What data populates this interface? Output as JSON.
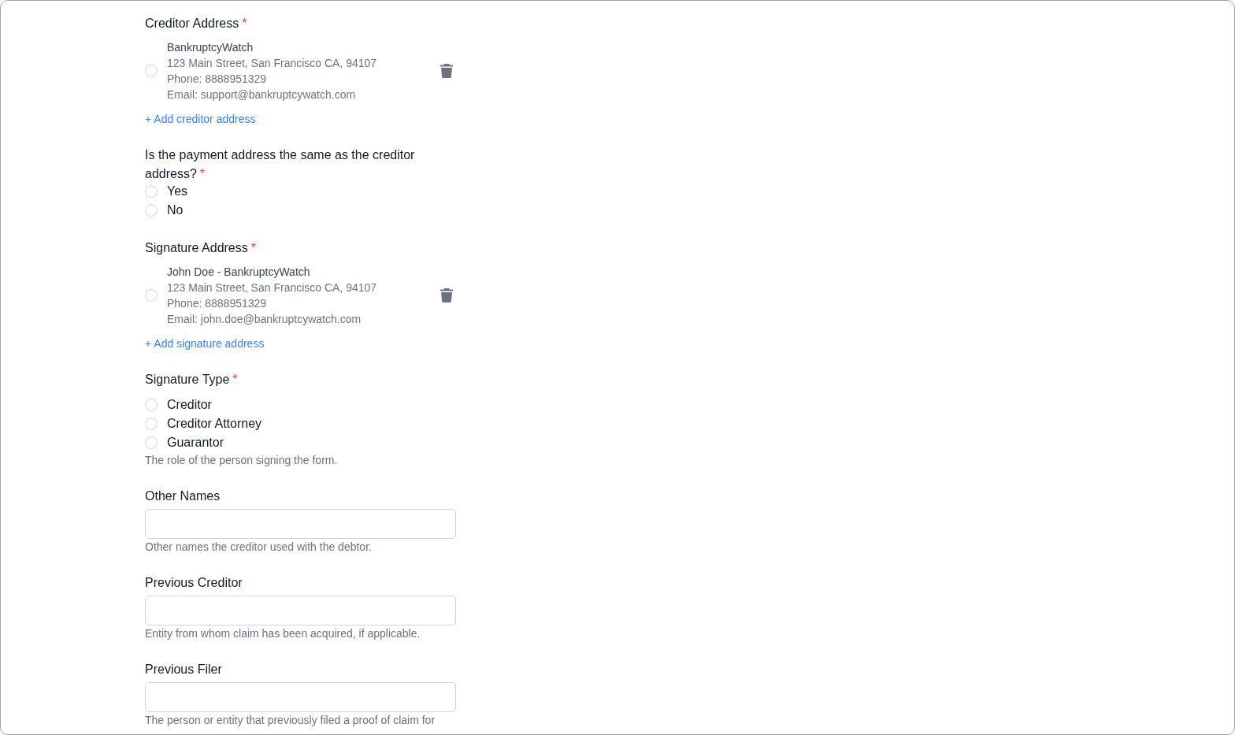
{
  "sections": [
    {
      "kind": "address_list",
      "label": "Creditor Address",
      "required_mark": "*",
      "addresses": [
        {
          "name": "BankruptcyWatch",
          "lines": [
            "123 Main Street, San Francisco CA, 94107",
            "Phone: 8888951329",
            "Email: support@bankruptcywatch.com"
          ],
          "selected": false
        }
      ],
      "add_link": "+ Add creditor address"
    },
    {
      "kind": "radio_group",
      "label": "Is the payment address the same as the creditor address?",
      "required_mark": "*",
      "options": [
        {
          "label": "Yes",
          "selected": false
        },
        {
          "label": "No",
          "selected": false
        }
      ]
    },
    {
      "kind": "address_list",
      "label": "Signature Address",
      "required_mark": "*",
      "addresses": [
        {
          "name": "John Doe - BankruptcyWatch",
          "lines": [
            "123 Main Street, San Francisco CA, 94107",
            "Phone: 8888951329",
            "Email: john.doe@bankruptcywatch.com"
          ],
          "selected": false
        }
      ],
      "add_link": "+ Add signature address"
    },
    {
      "kind": "radio_group",
      "label": "Signature Type",
      "required_mark": "*",
      "options": [
        {
          "label": "Creditor",
          "selected": false
        },
        {
          "label": "Creditor Attorney",
          "selected": false
        },
        {
          "label": "Guarantor",
          "selected": false
        }
      ],
      "help": "The role of the person signing the form."
    },
    {
      "kind": "text_field",
      "label": "Other Names",
      "help": "Other names the creditor used with the debtor."
    },
    {
      "kind": "text_field",
      "label": "Previous Creditor",
      "help": "Entity from whom claim has been acquired, if applicable."
    },
    {
      "kind": "text_field",
      "label": "Previous Filer",
      "help": "The person or entity that previously filed a proof of claim for"
    }
  ]
}
